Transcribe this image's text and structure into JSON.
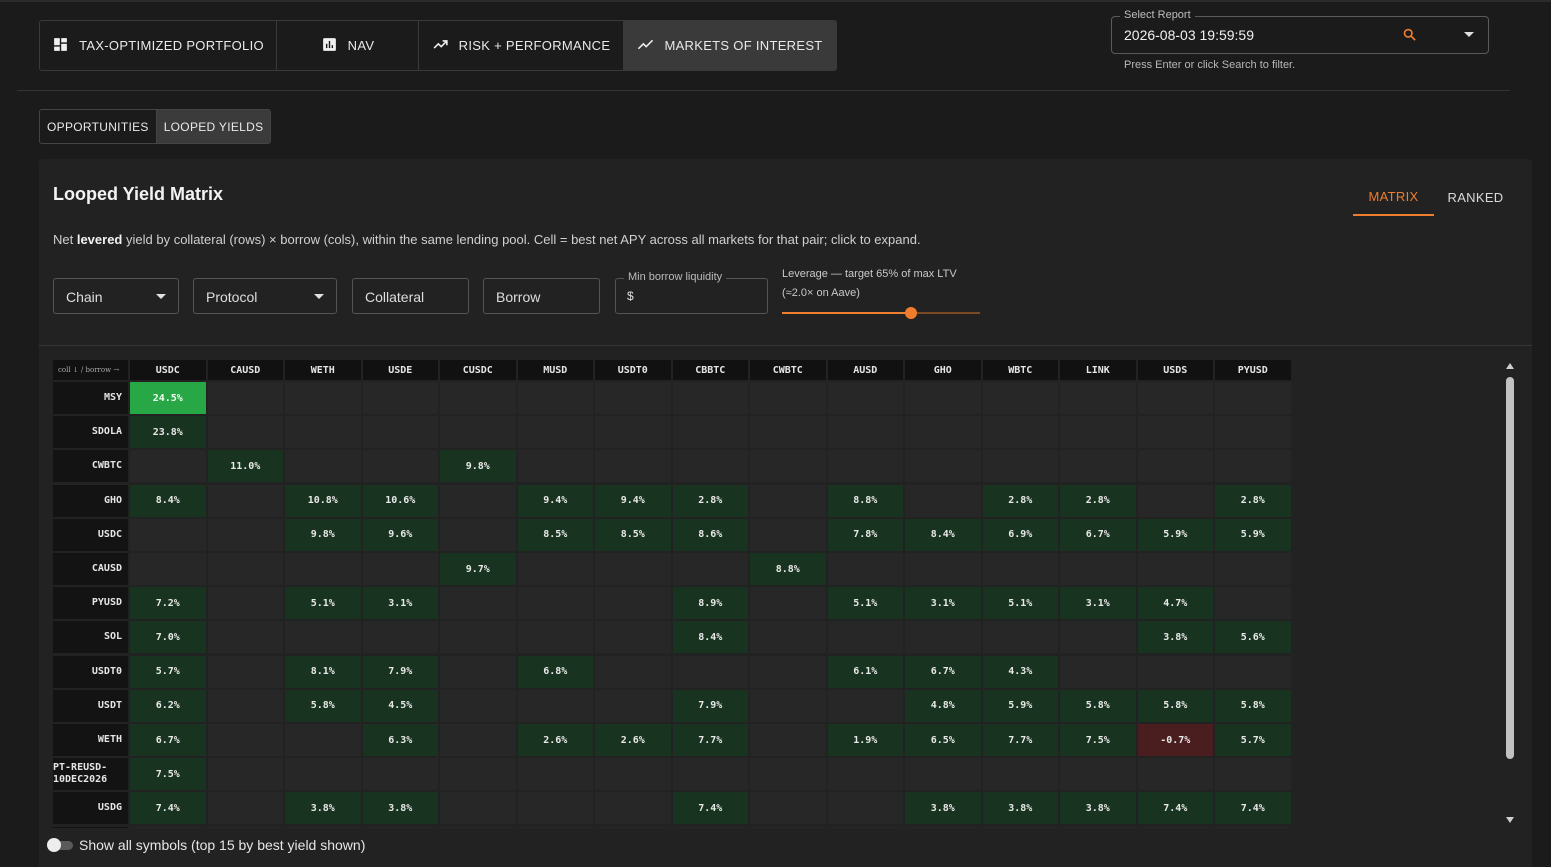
{
  "nav": {
    "tabs": [
      {
        "label": "TAX-OPTIMIZED PORTFOLIO",
        "icon": "dashboard-icon"
      },
      {
        "label": "NAV",
        "icon": "bar-chart-icon"
      },
      {
        "label": "RISK + PERFORMANCE",
        "icon": "trending-up-icon"
      },
      {
        "label": "MARKETS OF INTEREST",
        "icon": "trending-line-icon",
        "active": true
      }
    ]
  },
  "report": {
    "label": "Select Report",
    "value": "2026-08-03 19:59:59",
    "help": "Press Enter or click Search to filter."
  },
  "sub_tabs": [
    {
      "label": "OPPORTUNITIES"
    },
    {
      "label": "LOOPED YIELDS",
      "active": true
    }
  ],
  "panel": {
    "title": "Looped Yield Matrix",
    "view_tabs": [
      {
        "label": "MATRIX",
        "active": true
      },
      {
        "label": "RANKED"
      }
    ],
    "desc_pre": "Net ",
    "desc_bold": "levered",
    "desc_post": " yield by collateral (rows) × borrow (cols), within the same lending pool. Cell = best net APY across all markets for that pair; click to expand."
  },
  "filters": {
    "chain": "Chain",
    "protocol": "Protocol",
    "collateral": "Collateral",
    "borrow": "Borrow",
    "min_liquidity_label": "Min borrow liquidity",
    "min_liquidity_prefix": "$",
    "leverage_label": "Leverage — target 65% of max LTV",
    "leverage_sub": "(≈2.0× on Aave)",
    "leverage_fraction": 0.65
  },
  "matrix": {
    "corner": "coll ↓ / borrow →",
    "columns": [
      "USDC",
      "CAUSD",
      "WETH",
      "USDE",
      "CUSDC",
      "MUSD",
      "USDT0",
      "CBBTC",
      "CWBTC",
      "AUSD",
      "GHO",
      "WBTC",
      "LINK",
      "USDS",
      "PYUSD"
    ],
    "rows": [
      {
        "label": "MSY",
        "cells": [
          "24.5%",
          "",
          "",
          "",
          "",
          "",
          "",
          "",
          "",
          "",
          "",
          "",
          "",
          "",
          ""
        ]
      },
      {
        "label": "SDOLA",
        "cells": [
          "23.8%",
          "",
          "",
          "",
          "",
          "",
          "",
          "",
          "",
          "",
          "",
          "",
          "",
          "",
          ""
        ]
      },
      {
        "label": "CWBTC",
        "cells": [
          "",
          "11.0%",
          "",
          "",
          "9.8%",
          "",
          "",
          "",
          "",
          "",
          "",
          "",
          "",
          "",
          ""
        ]
      },
      {
        "label": "GHO",
        "cells": [
          "8.4%",
          "",
          "10.8%",
          "10.6%",
          "",
          "9.4%",
          "9.4%",
          "2.8%",
          "",
          "8.8%",
          "",
          "2.8%",
          "2.8%",
          "",
          "2.8%"
        ]
      },
      {
        "label": "USDC",
        "cells": [
          "",
          "",
          "9.8%",
          "9.6%",
          "",
          "8.5%",
          "8.5%",
          "8.6%",
          "",
          "7.8%",
          "8.4%",
          "6.9%",
          "6.7%",
          "5.9%",
          "5.9%"
        ]
      },
      {
        "label": "CAUSD",
        "cells": [
          "",
          "",
          "",
          "",
          "9.7%",
          "",
          "",
          "",
          "8.8%",
          "",
          "",
          "",
          "",
          "",
          ""
        ]
      },
      {
        "label": "PYUSD",
        "cells": [
          "7.2%",
          "",
          "5.1%",
          "3.1%",
          "",
          "",
          "",
          "8.9%",
          "",
          "5.1%",
          "3.1%",
          "5.1%",
          "3.1%",
          "4.7%",
          ""
        ]
      },
      {
        "label": "SOL",
        "cells": [
          "7.0%",
          "",
          "",
          "",
          "",
          "",
          "",
          "8.4%",
          "",
          "",
          "",
          "",
          "",
          "3.8%",
          "5.6%"
        ]
      },
      {
        "label": "USDT0",
        "cells": [
          "5.7%",
          "",
          "8.1%",
          "7.9%",
          "",
          "6.8%",
          "",
          "",
          "",
          "6.1%",
          "6.7%",
          "4.3%",
          "",
          "",
          ""
        ]
      },
      {
        "label": "USDT",
        "cells": [
          "6.2%",
          "",
          "5.8%",
          "4.5%",
          "",
          "",
          "",
          "7.9%",
          "",
          "",
          "4.8%",
          "5.9%",
          "5.8%",
          "5.8%",
          "5.8%"
        ]
      },
      {
        "label": "WETH",
        "cells": [
          "6.7%",
          "",
          "",
          "6.3%",
          "",
          "2.6%",
          "2.6%",
          "7.7%",
          "",
          "1.9%",
          "6.5%",
          "7.7%",
          "7.5%",
          "-0.7%",
          "5.7%"
        ]
      },
      {
        "label": "PT-REUSD-10DEC2026",
        "cells": [
          "7.5%",
          "",
          "",
          "",
          "",
          "",
          "",
          "",
          "",
          "",
          "",
          "",
          "",
          "",
          ""
        ]
      },
      {
        "label": "USDG",
        "cells": [
          "7.4%",
          "",
          "3.8%",
          "3.8%",
          "",
          "",
          "",
          "7.4%",
          "",
          "",
          "3.8%",
          "3.8%",
          "3.8%",
          "7.4%",
          "7.4%"
        ]
      },
      {
        "label": "",
        "cells": [
          "",
          "",
          "",
          "",
          "",
          "",
          "",
          "",
          "",
          "",
          "",
          "",
          "",
          "",
          ""
        ]
      }
    ]
  },
  "toggle": {
    "label": "Show all symbols (top 15 by best yield shown)",
    "on": false
  }
}
